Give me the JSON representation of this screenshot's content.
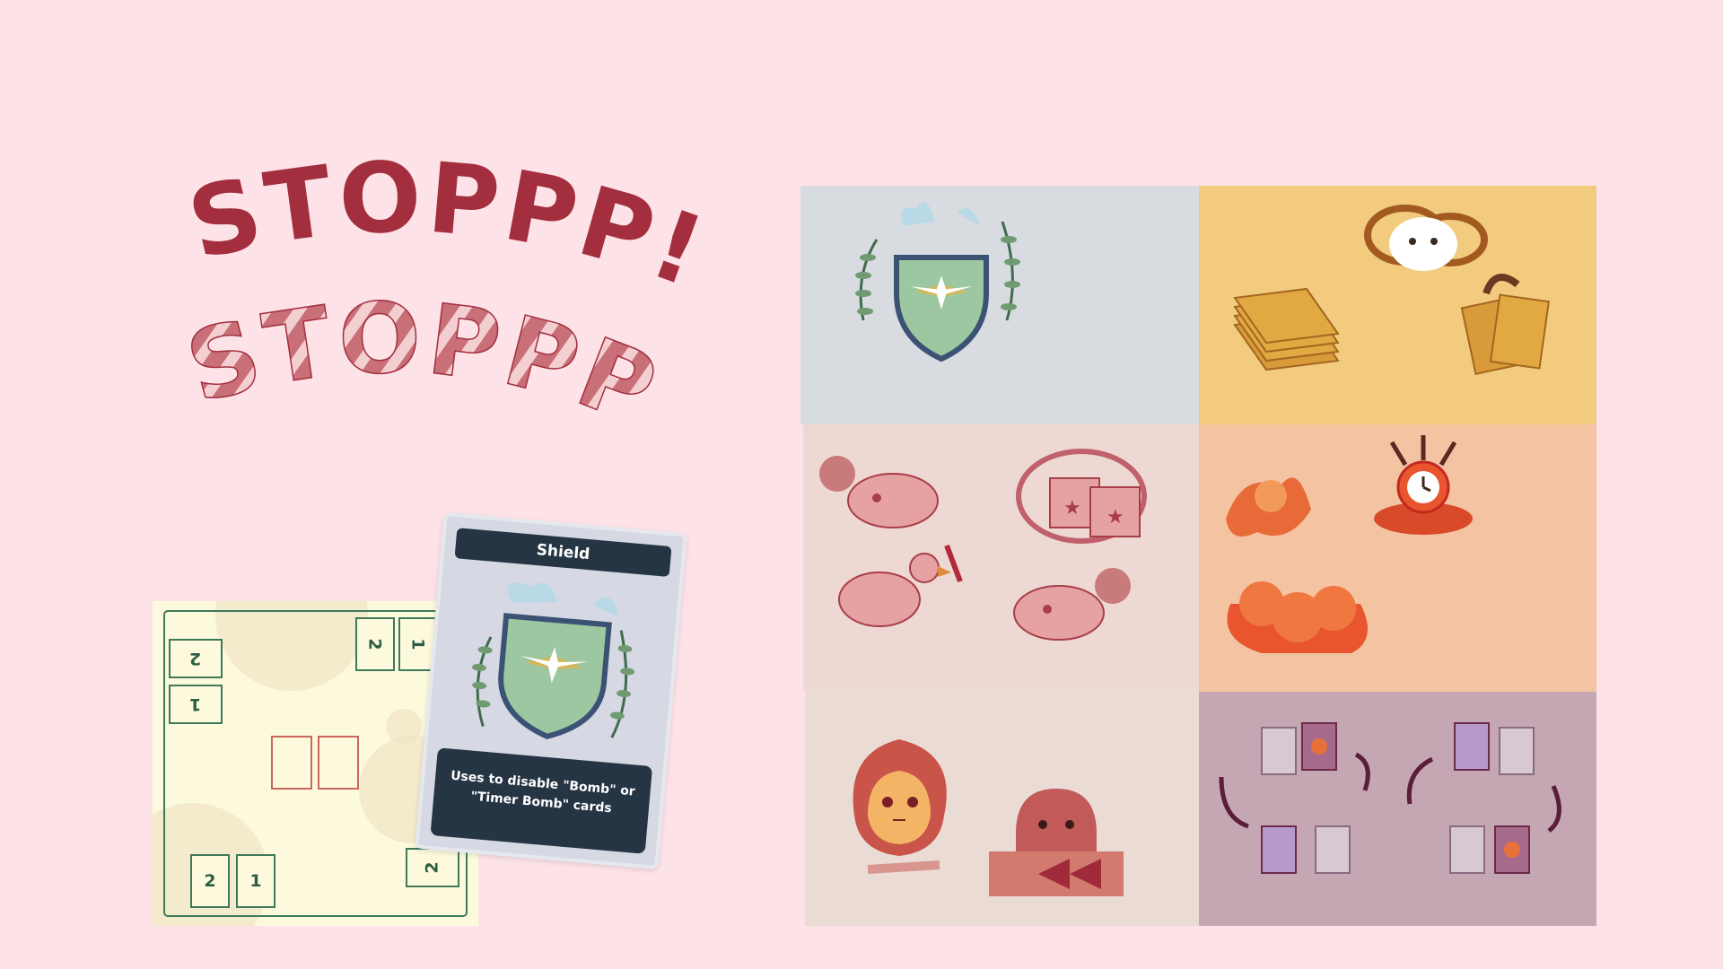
{
  "title": {
    "line1": "STOPPP!",
    "line2": "STOPPP!",
    "colors": {
      "main": "#a32e3e",
      "pattern": "#d98b91"
    }
  },
  "board": {
    "slots": [
      "2",
      "1",
      "2",
      "1",
      "2",
      "1",
      "2",
      "",
      ""
    ]
  },
  "card": {
    "name": "Shield",
    "description": "Uses to disable \"Bomb\" or \"Timer Bomb\" cards",
    "icons": [
      "shield-icon",
      "bird-icon",
      "leaf-icon"
    ]
  },
  "panels": [
    {
      "id": "shield-art",
      "icons": [
        "shield-icon",
        "bird-icon",
        "leaf-icon"
      ],
      "bg": "#d8dbe0"
    },
    {
      "id": "cards-art",
      "icons": [
        "cloud-creature-icon",
        "card-deck-icon",
        "card-pair-icon"
      ],
      "bg": "#f2cb7e"
    },
    {
      "id": "characters-art",
      "icons": [
        "bomb-fish-icon",
        "dice-icon",
        "knife-bird-icon",
        "bomb-fish-icon"
      ],
      "bg": "#edd8d3"
    },
    {
      "id": "bombs-art",
      "icons": [
        "bomb-splash-icon",
        "timer-bomb-icon",
        "bomb-cluster-icon"
      ],
      "bg": "#f4c3a2"
    },
    {
      "id": "creatures-art",
      "icons": [
        "fire-creature-icon",
        "rewind-monster-icon"
      ],
      "bg": "#ebdbd5"
    },
    {
      "id": "swap-art",
      "icons": [
        "card-swap-icon",
        "curved-arrow-icon"
      ],
      "bg": "#c5a7b3"
    }
  ]
}
